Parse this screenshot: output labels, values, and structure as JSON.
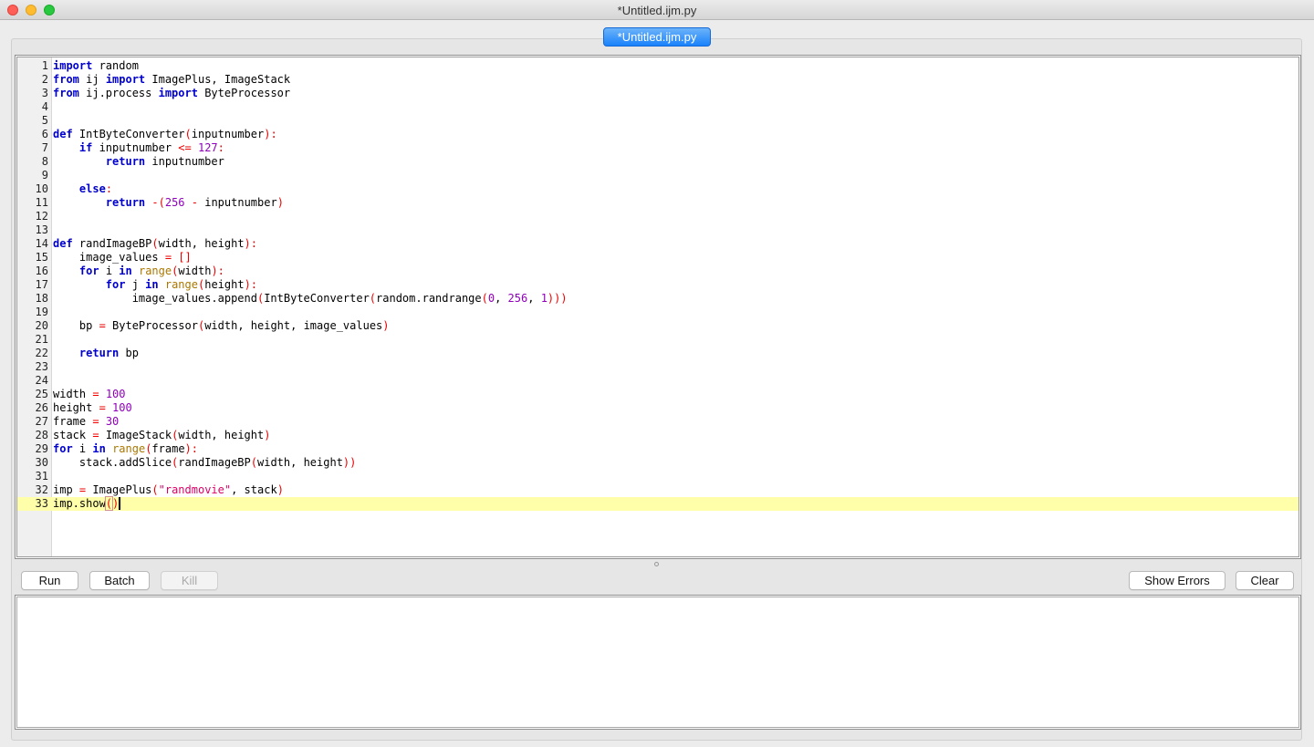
{
  "window": {
    "title": "*Untitled.ijm.py"
  },
  "tabs": [
    {
      "label": "*Untitled.ijm.py",
      "active": true
    }
  ],
  "colors": {
    "keyword": "#0000cc",
    "builtin": "#aa7700",
    "number": "#9000bb",
    "string": "#dd0066",
    "operator": "#ee0000",
    "current_line": "#ffffaa",
    "tab_active": "#1a82fb"
  },
  "editor": {
    "current_line": 33,
    "lines": [
      [
        [
          "kw",
          "import"
        ],
        [
          "t",
          " random"
        ]
      ],
      [
        [
          "kw",
          "from"
        ],
        [
          "t",
          " ij "
        ],
        [
          "kw",
          "import"
        ],
        [
          "t",
          " ImagePlus, ImageStack"
        ]
      ],
      [
        [
          "kw",
          "from"
        ],
        [
          "t",
          " ij.process "
        ],
        [
          "kw",
          "import"
        ],
        [
          "t",
          " ByteProcessor"
        ]
      ],
      [],
      [],
      [
        [
          "kw",
          "def"
        ],
        [
          "t",
          " IntByteConverter"
        ],
        [
          "op",
          "("
        ],
        [
          "t",
          "inputnumber"
        ],
        [
          "op",
          "):"
        ]
      ],
      [
        [
          "t",
          "    "
        ],
        [
          "kw",
          "if"
        ],
        [
          "t",
          " inputnumber "
        ],
        [
          "op",
          "<="
        ],
        [
          "t",
          " "
        ],
        [
          "num",
          "127"
        ],
        [
          "op",
          ":"
        ]
      ],
      [
        [
          "t",
          "        "
        ],
        [
          "kw",
          "return"
        ],
        [
          "t",
          " inputnumber"
        ]
      ],
      [],
      [
        [
          "t",
          "    "
        ],
        [
          "kw",
          "else"
        ],
        [
          "op",
          ":"
        ]
      ],
      [
        [
          "t",
          "        "
        ],
        [
          "kw",
          "return"
        ],
        [
          "t",
          " "
        ],
        [
          "op",
          "-("
        ],
        [
          "num",
          "256"
        ],
        [
          "t",
          " "
        ],
        [
          "op",
          "-"
        ],
        [
          "t",
          " inputnumber"
        ],
        [
          "op",
          ")"
        ]
      ],
      [],
      [],
      [
        [
          "kw",
          "def"
        ],
        [
          "t",
          " randImageBP"
        ],
        [
          "op",
          "("
        ],
        [
          "t",
          "width, height"
        ],
        [
          "op",
          "):"
        ]
      ],
      [
        [
          "t",
          "    image_values "
        ],
        [
          "op",
          "="
        ],
        [
          "t",
          " "
        ],
        [
          "op",
          "[]"
        ]
      ],
      [
        [
          "t",
          "    "
        ],
        [
          "kw",
          "for"
        ],
        [
          "t",
          " i "
        ],
        [
          "kw",
          "in"
        ],
        [
          "t",
          " "
        ],
        [
          "bi",
          "range"
        ],
        [
          "op",
          "("
        ],
        [
          "t",
          "width"
        ],
        [
          "op",
          "):"
        ]
      ],
      [
        [
          "t",
          "        "
        ],
        [
          "kw",
          "for"
        ],
        [
          "t",
          " j "
        ],
        [
          "kw",
          "in"
        ],
        [
          "t",
          " "
        ],
        [
          "bi",
          "range"
        ],
        [
          "op",
          "("
        ],
        [
          "t",
          "height"
        ],
        [
          "op",
          "):"
        ]
      ],
      [
        [
          "t",
          "            image_values.append"
        ],
        [
          "op",
          "("
        ],
        [
          "t",
          "IntByteConverter"
        ],
        [
          "op",
          "("
        ],
        [
          "t",
          "random.randrange"
        ],
        [
          "op",
          "("
        ],
        [
          "num",
          "0"
        ],
        [
          "t",
          ", "
        ],
        [
          "num",
          "256"
        ],
        [
          "t",
          ", "
        ],
        [
          "num",
          "1"
        ],
        [
          "op",
          ")))"
        ]
      ],
      [],
      [
        [
          "t",
          "    bp "
        ],
        [
          "op",
          "="
        ],
        [
          "t",
          " ByteProcessor"
        ],
        [
          "op",
          "("
        ],
        [
          "t",
          "width, height, image_values"
        ],
        [
          "op",
          ")"
        ]
      ],
      [],
      [
        [
          "t",
          "    "
        ],
        [
          "kw",
          "return"
        ],
        [
          "t",
          " bp"
        ]
      ],
      [],
      [],
      [
        [
          "t",
          "width "
        ],
        [
          "op",
          "="
        ],
        [
          "t",
          " "
        ],
        [
          "num",
          "100"
        ]
      ],
      [
        [
          "t",
          "height "
        ],
        [
          "op",
          "="
        ],
        [
          "t",
          " "
        ],
        [
          "num",
          "100"
        ]
      ],
      [
        [
          "t",
          "frame "
        ],
        [
          "op",
          "="
        ],
        [
          "t",
          " "
        ],
        [
          "num",
          "30"
        ]
      ],
      [
        [
          "t",
          "stack "
        ],
        [
          "op",
          "="
        ],
        [
          "t",
          " ImageStack"
        ],
        [
          "op",
          "("
        ],
        [
          "t",
          "width, height"
        ],
        [
          "op",
          ")"
        ]
      ],
      [
        [
          "kw",
          "for"
        ],
        [
          "t",
          " i "
        ],
        [
          "kw",
          "in"
        ],
        [
          "t",
          " "
        ],
        [
          "bi",
          "range"
        ],
        [
          "op",
          "("
        ],
        [
          "t",
          "frame"
        ],
        [
          "op",
          "):"
        ]
      ],
      [
        [
          "t",
          "    stack.addSlice"
        ],
        [
          "op",
          "("
        ],
        [
          "t",
          "randImageBP"
        ],
        [
          "op",
          "("
        ],
        [
          "t",
          "width, height"
        ],
        [
          "op",
          "))"
        ]
      ],
      [],
      [
        [
          "t",
          "imp "
        ],
        [
          "op",
          "="
        ],
        [
          "t",
          " ImagePlus"
        ],
        [
          "op",
          "("
        ],
        [
          "str",
          "\"randmovie\""
        ],
        [
          "t",
          ", stack"
        ],
        [
          "op",
          ")"
        ]
      ],
      [
        [
          "t",
          "imp.show"
        ],
        [
          "br",
          "("
        ],
        [
          "op",
          ")"
        ],
        [
          "caret",
          ""
        ]
      ]
    ]
  },
  "toolbar": {
    "run": "Run",
    "batch": "Batch",
    "kill": "Kill",
    "show_errors": "Show Errors",
    "clear": "Clear"
  },
  "icons": {
    "close": "close-icon",
    "minimize": "minimize-icon",
    "zoom": "zoom-icon",
    "splitter": "splitter-handle-icon"
  }
}
